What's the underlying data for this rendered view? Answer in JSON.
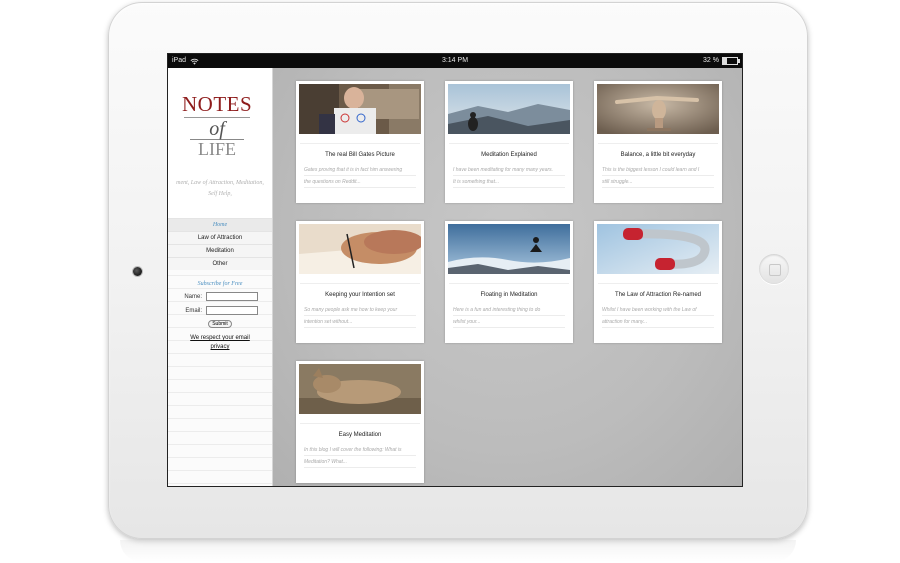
{
  "statusbar": {
    "device": "iPad",
    "time": "3:14 PM",
    "battery": "32 %"
  },
  "sidebar": {
    "logo": {
      "line1": "NOTES",
      "line2": "of",
      "line3": "LIFE"
    },
    "tagline": [
      "ment, Law of Attraction, Meditation,",
      "Self Help,"
    ],
    "nav": [
      {
        "label": "Home"
      },
      {
        "label": "Law of Attraction"
      },
      {
        "label": "Meditation"
      },
      {
        "label": "Other"
      }
    ],
    "subscribe": {
      "title": "Subscribe for Free",
      "name_label": "Name:",
      "email_label": "Email:",
      "submit_label": "Submit",
      "respect_line1": "We respect your email",
      "respect_line2": "privacy"
    }
  },
  "posts": [
    {
      "title": "The real Bill Gates Picture",
      "excerpt": [
        "Gates proving that it is in fact him answering",
        "the questions on Reddit..."
      ],
      "image": "person-holding-drawing"
    },
    {
      "title": "Meditation Explained",
      "excerpt": [
        "I have been meditating for many many years.",
        "It is something that..."
      ],
      "image": "person-on-mountain"
    },
    {
      "title": "Balance, a little bit everyday",
      "excerpt": [
        "This is the biggest lesson I could learn and I",
        "still struggle..."
      ],
      "image": "balancing-figure"
    },
    {
      "title": "Keeping your Intention set",
      "excerpt": [
        "So many people ask me how to keep your",
        "intention set without..."
      ],
      "image": "hand-writing"
    },
    {
      "title": "Floating in Meditation",
      "excerpt": [
        "Here is a fun and interesting thing to do",
        "whilst your..."
      ],
      "image": "floating-meditator"
    },
    {
      "title": "The Law of Attraction Re-named",
      "excerpt": [
        "Whilst I have been working with the Law of",
        "attraction for many..."
      ],
      "image": "magnet"
    },
    {
      "title": "Easy Meditation",
      "excerpt": [
        "In this blog I will cover the following: What is",
        "Meditation? What..."
      ],
      "image": "sleeping-animal"
    }
  ]
}
